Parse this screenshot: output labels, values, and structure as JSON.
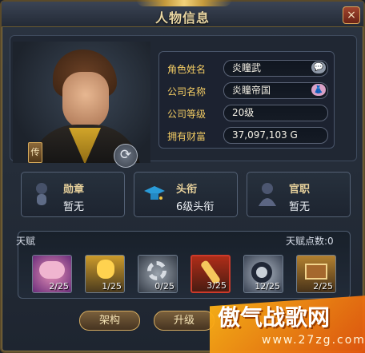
{
  "window": {
    "title": "人物信息",
    "close": "×"
  },
  "character": {
    "name_label": "角色姓名",
    "name_value": "炎瞳武",
    "company_label": "公司名称",
    "company_value": "炎瞳帝国",
    "level_label": "公司等级",
    "level_value": "20级",
    "wealth_label": "拥有财富",
    "wealth_value": "37,097,103 G",
    "chat_icon": "speech-bubble-icon",
    "company_icon": "dress-icon"
  },
  "portrait": {
    "pass_label": "传",
    "rotate_symbol": "⟳"
  },
  "titles": [
    {
      "name": "勋章",
      "value": "暂无",
      "icon": "medal-icon"
    },
    {
      "name": "头衔",
      "value": "6级头衔",
      "icon": "mortarboard-icon"
    },
    {
      "name": "官职",
      "value": "暂无",
      "icon": "user-silhouette-icon"
    }
  ],
  "talents": {
    "label": "天赋",
    "points_label": "天赋点数:0",
    "items": [
      {
        "level": "2/25",
        "icon": "brain-icon"
      },
      {
        "level": "1/25",
        "icon": "engineer-icon"
      },
      {
        "level": "0/25",
        "icon": "gear-icon"
      },
      {
        "level": "3/25",
        "icon": "wrench-icon"
      },
      {
        "level": "12/25",
        "icon": "tire-icon"
      },
      {
        "level": "2/25",
        "icon": "toolbox-icon"
      }
    ]
  },
  "buttons": {
    "structure": "架构",
    "upgrade": "升级"
  },
  "watermark": {
    "main": "傲气战歌网",
    "sub": "www.27zg.com"
  }
}
